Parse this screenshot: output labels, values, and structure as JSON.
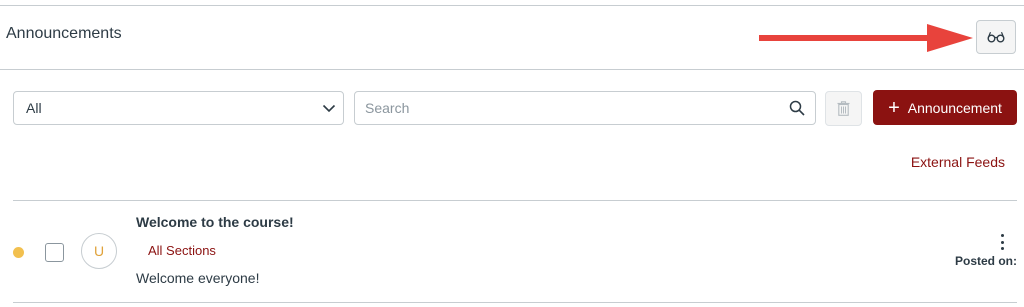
{
  "header": {
    "title": "Announcements",
    "immersive_reader_icon": "glasses-icon",
    "annotation_arrow_color": "#e8433c"
  },
  "toolbar": {
    "filter": {
      "selected": "All",
      "icon": "chevron-down-icon"
    },
    "search": {
      "placeholder": "Search",
      "value": "",
      "icon": "search-icon"
    },
    "delete_icon": "trash-icon",
    "add_button": {
      "label": "Announcement",
      "icon": "plus-icon"
    },
    "external_feeds_label": "External Feeds"
  },
  "announcements": [
    {
      "unread": true,
      "avatar_initial": "U",
      "title": "Welcome to the course!",
      "sections": "All Sections",
      "message": "Welcome everyone!",
      "posted_label": "Posted on:"
    }
  ],
  "colors": {
    "brand": "#8b1211",
    "unread_dot": "#f2c04f",
    "text": "#2d3b45",
    "border": "#c7cdd1"
  }
}
